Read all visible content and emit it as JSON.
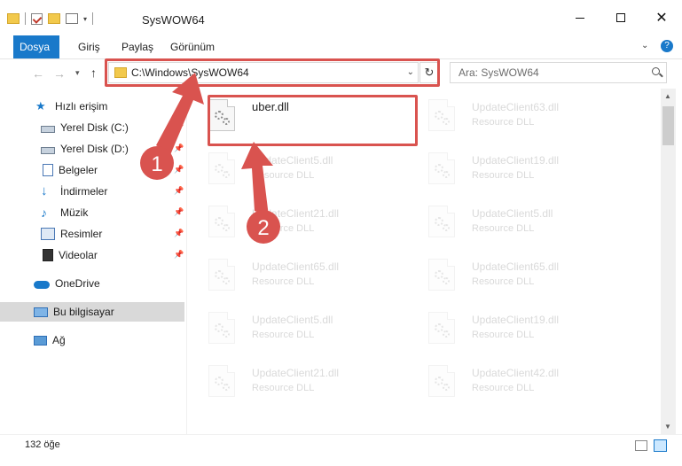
{
  "window": {
    "title": "SysWOW64"
  },
  "ribbon": {
    "tabs": [
      "Dosya",
      "Giriş",
      "Paylaş",
      "Görünüm"
    ],
    "help": "?"
  },
  "navigation": {
    "path": "C:\\Windows\\SysWOW64",
    "search_placeholder": "Ara: SysWOW64",
    "back": "←",
    "forward": "→",
    "up": "↑",
    "recent": "▾",
    "refresh": "↻",
    "dropdown": "⌄"
  },
  "sidebar": {
    "items": [
      {
        "label": "Hızlı erişim",
        "icon": "star-icon"
      },
      {
        "label": "Yerel Disk (C:)",
        "icon": "disk-icon"
      },
      {
        "label": "Yerel Disk (D:)",
        "icon": "disk-icon"
      },
      {
        "label": "Belgeler",
        "icon": "documents-icon"
      },
      {
        "label": "İndirmeler",
        "icon": "downloads-icon"
      },
      {
        "label": "Müzik",
        "icon": "music-icon"
      },
      {
        "label": "Resimler",
        "icon": "pictures-icon"
      },
      {
        "label": "Videolar",
        "icon": "videos-icon"
      },
      {
        "label": "OneDrive",
        "icon": "cloud-icon"
      },
      {
        "label": "Bu bilgisayar",
        "icon": "computer-icon"
      },
      {
        "label": "Ağ",
        "icon": "network-icon"
      }
    ],
    "pin": "📌"
  },
  "files": [
    {
      "name": "uber.dll",
      "type": ""
    },
    {
      "name": "UpdateClient63.dll",
      "type": "Resource DLL"
    },
    {
      "name": "UpdateClient5.dll",
      "type": "Resource DLL"
    },
    {
      "name": "UpdateClient19.dll",
      "type": "Resource DLL"
    },
    {
      "name": "UpdateClient21.dll",
      "type": "Resource DLL"
    },
    {
      "name": "UpdateClient5.dll",
      "type": "Resource DLL"
    },
    {
      "name": "UpdateClient65.dll",
      "type": "Resource DLL"
    },
    {
      "name": "UpdateClient65.dll",
      "type": "Resource DLL"
    },
    {
      "name": "UpdateClient5.dll",
      "type": "Resource DLL"
    },
    {
      "name": "UpdateClient19.dll",
      "type": "Resource DLL"
    },
    {
      "name": "UpdateClient21.dll",
      "type": "Resource DLL"
    },
    {
      "name": "UpdateClient42.dll",
      "type": "Resource DLL"
    }
  ],
  "status": {
    "count": "132 öğe"
  },
  "annotations": {
    "step1": "1",
    "step2": "2",
    "color": "#d9534f"
  },
  "colors": {
    "accent": "#1979ca",
    "highlight": "#d9534f",
    "selected": "#d9d9d9"
  }
}
